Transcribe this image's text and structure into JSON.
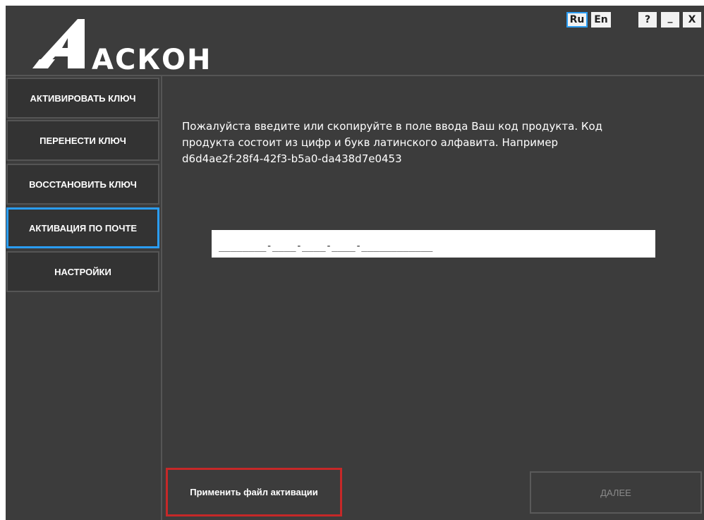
{
  "header": {
    "logo_text": "АСКОН",
    "lang_ru": "Ru",
    "lang_en": "En",
    "help": "?",
    "minimize": "_",
    "close": "X",
    "active_language": "Ru",
    "logo_icon": "askon-logo"
  },
  "sidebar": {
    "items": [
      {
        "label": "АКТИВИРОВАТЬ КЛЮЧ"
      },
      {
        "label": "ПЕРЕНЕСТИ КЛЮЧ"
      },
      {
        "label": "ВОССТАНОВИТЬ КЛЮЧ"
      },
      {
        "label": "АКТИВАЦИЯ ПО ПОЧТЕ"
      },
      {
        "label": "НАСТРОЙКИ"
      }
    ],
    "selected": "АКТИВАЦИЯ ПО ПОЧТЕ"
  },
  "main": {
    "instruction_lines": [
      "Пожалуйста введите или скопируйте в поле ввода Ваш код продукта. Код",
      "продукта состоит из цифр и букв латинского алфавита. Например",
      "d6d4ae2f-28f4-42f3-b5a0-da438d7e0453"
    ],
    "product_key_value": "________-____-____-____-____________",
    "apply_file_button": "Применить файл активации",
    "next_button": "ДАЛЕЕ"
  },
  "colors": {
    "background": "#3c3c3c",
    "accent_blue": "#2a9df4",
    "highlight_red": "#c62828"
  }
}
